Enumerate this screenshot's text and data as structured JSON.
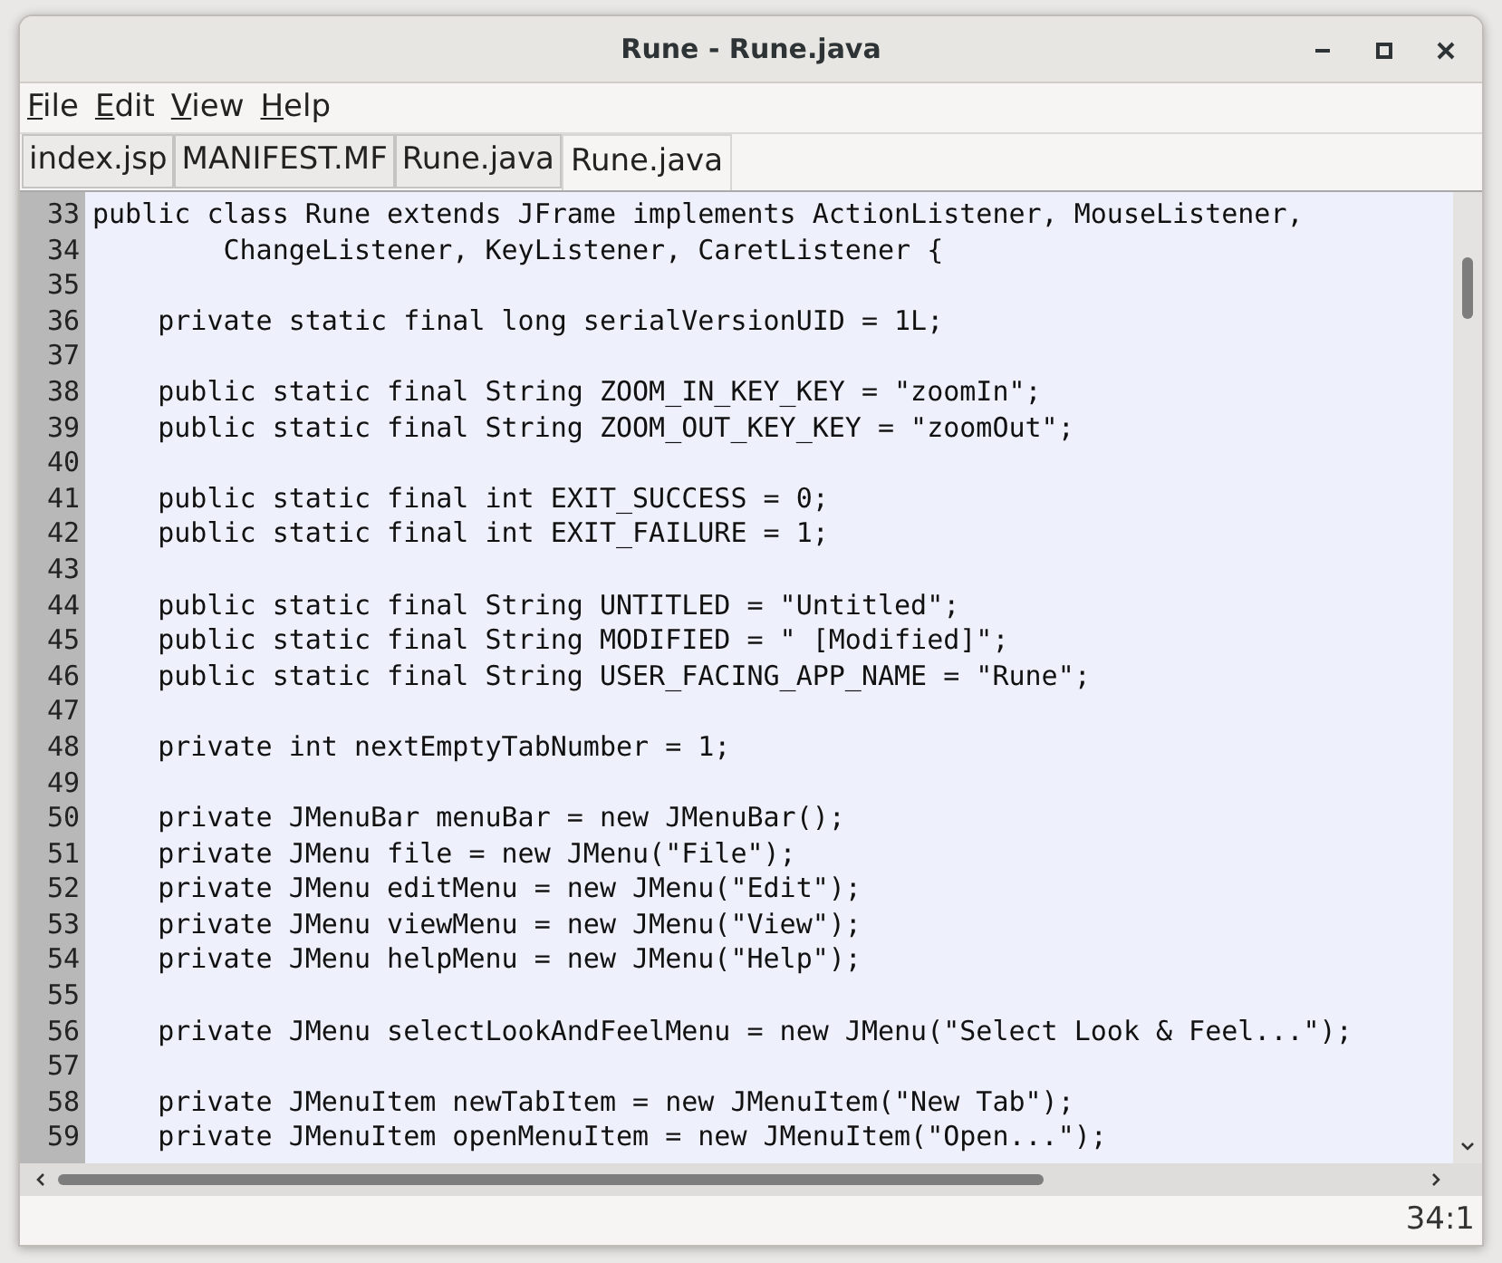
{
  "window": {
    "title": "Rune - Rune.java"
  },
  "menu": [
    "File",
    "Edit",
    "View",
    "Help"
  ],
  "tabs": [
    {
      "label": "index.jsp",
      "selected": false
    },
    {
      "label": "MANIFEST.MF",
      "selected": false
    },
    {
      "label": "Rune.java",
      "selected": false
    },
    {
      "label": "Rune.java",
      "selected": true
    }
  ],
  "editor": {
    "lines": [
      {
        "number": "33",
        "text": "public class Rune extends JFrame implements ActionListener, MouseListener,"
      },
      {
        "number": "34",
        "text": "        ChangeListener, KeyListener, CaretListener {"
      },
      {
        "number": "35"
      },
      {
        "number": "36",
        "text": "    private static final long serialVersionUID = 1L;"
      },
      {
        "number": "37"
      },
      {
        "number": "38",
        "text": "    public static final String ZOOM_IN_KEY_KEY = \"zoomIn\";"
      },
      {
        "number": "39",
        "text": "    public static final String ZOOM_OUT_KEY_KEY = \"zoomOut\";"
      },
      {
        "number": "40"
      },
      {
        "number": "41",
        "text": "    public static final int EXIT_SUCCESS = 0;"
      },
      {
        "number": "42",
        "text": "    public static final int EXIT_FAILURE = 1;"
      },
      {
        "number": "43"
      },
      {
        "number": "44",
        "text": "    public static final String UNTITLED = \"Untitled\";"
      },
      {
        "number": "45",
        "text": "    public static final String MODIFIED = \" [Modified]\";"
      },
      {
        "number": "46",
        "text": "    public static final String USER_FACING_APP_NAME = \"Rune\";"
      },
      {
        "number": "47"
      },
      {
        "number": "48",
        "text": "    private int nextEmptyTabNumber = 1;"
      },
      {
        "number": "49"
      },
      {
        "number": "50",
        "text": "    private JMenuBar menuBar = new JMenuBar();"
      },
      {
        "number": "51",
        "text": "    private JMenu file = new JMenu(\"File\");"
      },
      {
        "number": "52",
        "text": "    private JMenu editMenu = new JMenu(\"Edit\");"
      },
      {
        "number": "53",
        "text": "    private JMenu viewMenu = new JMenu(\"View\");"
      },
      {
        "number": "54",
        "text": "    private JMenu helpMenu = new JMenu(\"Help\");"
      },
      {
        "number": "55"
      },
      {
        "number": "56",
        "text": "    private JMenu selectLookAndFeelMenu = new JMenu(\"Select Look & Feel...\");"
      },
      {
        "number": "57"
      },
      {
        "number": "58",
        "text": "    private JMenuItem newTabItem = new JMenuItem(\"New Tab\");"
      },
      {
        "number": "59",
        "text": "    private JMenuItem openMenuItem = new JMenuItem(\"Open...\");"
      }
    ]
  },
  "status_bar": {
    "position": "34:1"
  }
}
